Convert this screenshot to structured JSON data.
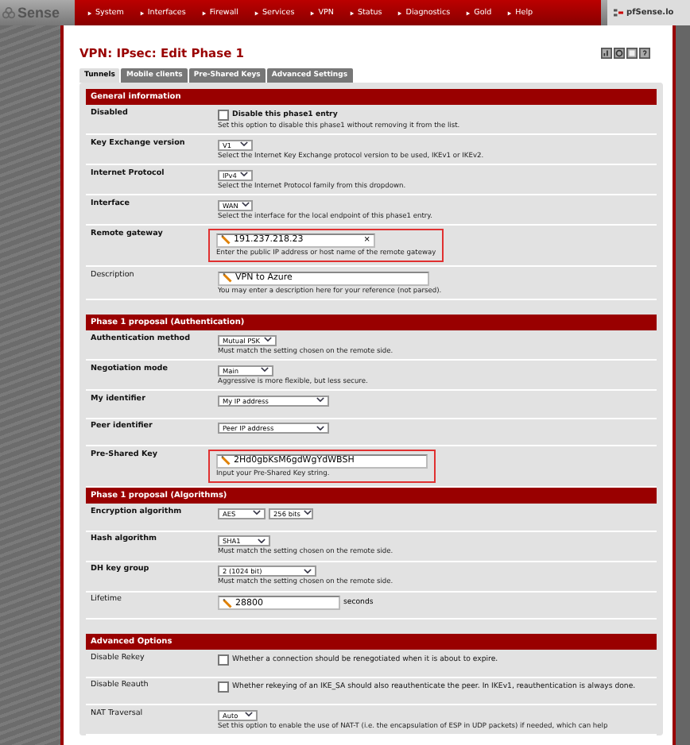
{
  "nav": {
    "logo": "Sense",
    "items": [
      "System",
      "Interfaces",
      "Firewall",
      "Services",
      "VPN",
      "Status",
      "Diagnostics",
      "Gold",
      "Help"
    ],
    "host": "pfSense.lo"
  },
  "page_title": "VPN: IPsec: Edit Phase 1",
  "tabs": [
    {
      "label": "Tunnels",
      "selected": true
    },
    {
      "label": "Mobile clients",
      "selected": false
    },
    {
      "label": "Pre-Shared Keys",
      "selected": false
    },
    {
      "label": "Advanced Settings",
      "selected": false
    }
  ],
  "sections": [
    {
      "title": "General information",
      "rows": [
        {
          "kind": "checkbox",
          "label": "Disabled",
          "bold": true,
          "checked": false,
          "check_label": "Disable this phase1 entry",
          "hint": "Set this option to disable this phase1 without removing it from the list."
        },
        {
          "kind": "select",
          "label": "Key Exchange version",
          "bold": true,
          "value": "V1",
          "hint": "Select the Internet Key Exchange protocol version to be used, IKEv1 or IKEv2."
        },
        {
          "kind": "select",
          "label": "Internet Protocol",
          "bold": true,
          "value": "IPv4",
          "hint": "Select the Internet Protocol family from this dropdown."
        },
        {
          "kind": "select",
          "label": "Interface",
          "bold": true,
          "value": "WAN",
          "hint": "Select the interface for the local endpoint of this phase1 entry."
        },
        {
          "kind": "text",
          "label": "Remote gateway",
          "bold": true,
          "value": "191.237.218.23",
          "clear": "×",
          "highlighted": true,
          "hint": "Enter the public IP address or host name of the remote gateway"
        },
        {
          "kind": "text",
          "label": "Description",
          "bold": false,
          "value": "VPN to Azure",
          "highlighted": false,
          "hint": "You may enter a description here for your reference (not parsed)."
        }
      ]
    },
    {
      "title": "Phase 1 proposal (Authentication)",
      "rows": [
        {
          "kind": "select",
          "label": "Authentication method",
          "bold": true,
          "value": "Mutual PSK",
          "hint": "Must match the setting chosen on the remote side."
        },
        {
          "kind": "select",
          "label": "Negotiation mode",
          "bold": true,
          "value": "Main",
          "hint": "Aggressive is more flexible, but less secure."
        },
        {
          "kind": "select",
          "label": "My identifier",
          "bold": true,
          "value": "My IP address"
        },
        {
          "kind": "select",
          "label": "Peer identifier",
          "bold": true,
          "value": "Peer IP address"
        },
        {
          "kind": "text",
          "label": "Pre-Shared Key",
          "bold": true,
          "value": "2Hd0gbKsM6gdWgYdWBSH",
          "highlighted": true,
          "hint": "Input your Pre-Shared Key string."
        }
      ]
    },
    {
      "title": "Phase 1 proposal (Algorithms)",
      "rows": [
        {
          "kind": "selects",
          "label": "Encryption algorithm",
          "bold": true,
          "values": [
            "AES",
            "256 bits"
          ]
        },
        {
          "kind": "select",
          "label": "Hash algorithm",
          "bold": true,
          "value": "SHA1",
          "hint": "Must match the setting chosen on the remote side."
        },
        {
          "kind": "select",
          "label": "DH key group",
          "bold": true,
          "value": "2 (1024 bit)",
          "hint": "Must match the setting chosen on the remote side."
        },
        {
          "kind": "text",
          "label": "Lifetime",
          "bold": false,
          "value": "28800",
          "suffix": "seconds",
          "highlighted": false
        }
      ]
    },
    {
      "title": "Advanced Options",
      "rows": [
        {
          "kind": "checkbox",
          "label": "Disable Rekey",
          "bold": false,
          "checked": false,
          "check_label": "Whether a connection should be renegotiated when it is about to expire."
        },
        {
          "kind": "checkbox",
          "label": "Disable Reauth",
          "bold": false,
          "checked": false,
          "check_label": "Whether rekeying of an IKE_SA should also reauthenticate the peer. In IKEv1, reauthentication is always done."
        },
        {
          "kind": "select",
          "label": "NAT Traversal",
          "bold": false,
          "value": "Auto",
          "hint": "Set this option to enable the use of NAT-T (i.e. the encapsulation of ESP in UDP packets) if needed, which can help"
        }
      ]
    }
  ]
}
